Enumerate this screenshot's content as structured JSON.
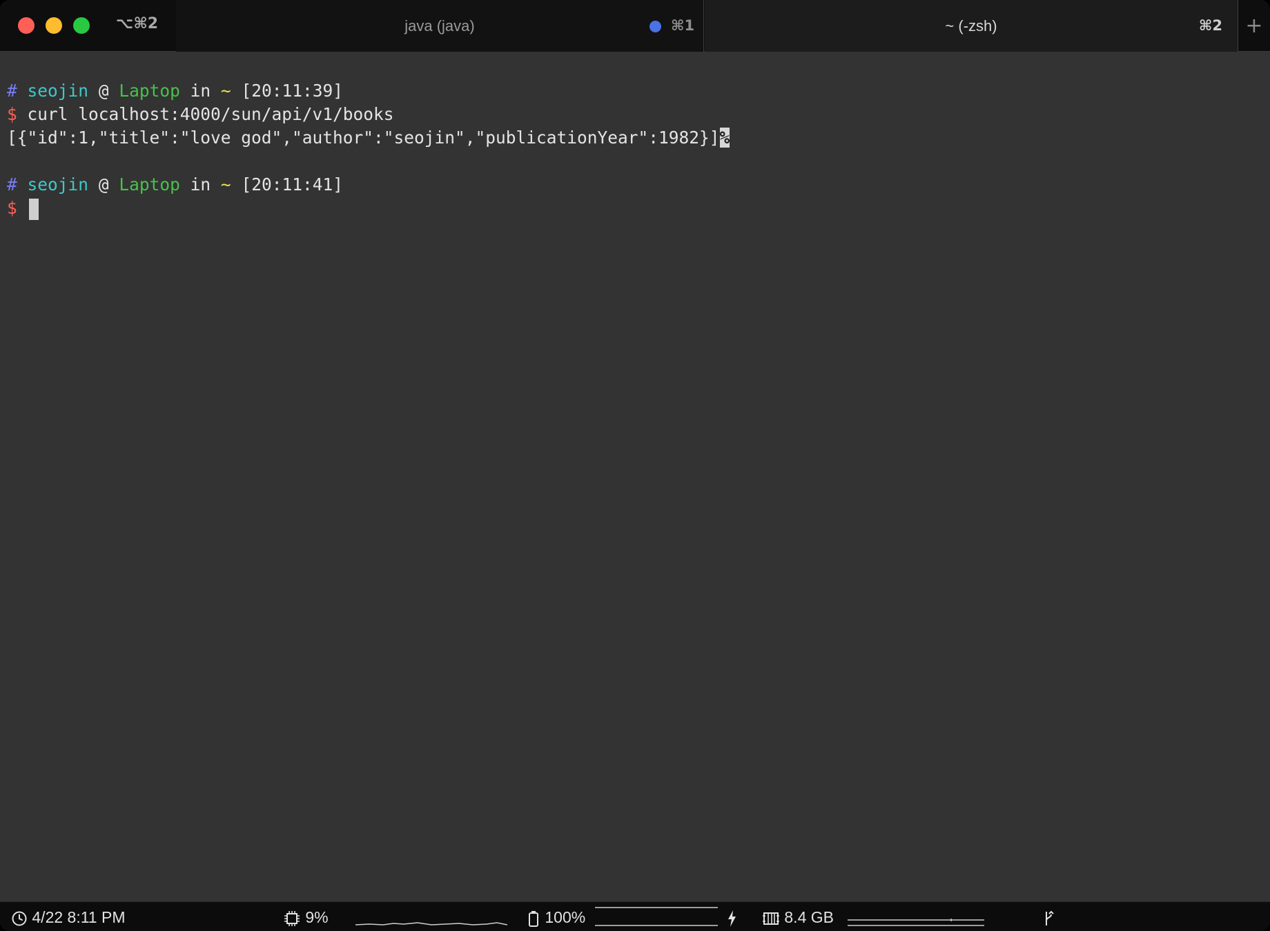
{
  "window": {
    "shortcut": "⌥⌘2"
  },
  "tabs": [
    {
      "title": "java (java)",
      "shortcut": "⌘1",
      "activity_dot_color": "#4a72e6"
    },
    {
      "title": "~ (-zsh)",
      "shortcut": "⌘2"
    }
  ],
  "new_tab": "+",
  "terminal": {
    "prompt1": {
      "hash": "#",
      "user": "seojin",
      "at": "@",
      "host": "Laptop",
      "in": "in",
      "dir": "~",
      "time": "[20:11:39]"
    },
    "command1": {
      "symbol": "$",
      "text": "curl localhost:4000/sun/api/v1/books"
    },
    "output1": {
      "text": "[{\"id\":1,\"title\":\"love god\",\"author\":\"seojin\",\"publicationYear\":1982}]",
      "eol_mark": "%"
    },
    "prompt2": {
      "hash": "#",
      "user": "seojin",
      "at": "@",
      "host": "Laptop",
      "in": "in",
      "dir": "~",
      "time": "[20:11:41]"
    },
    "command2": {
      "symbol": "$",
      "text": ""
    }
  },
  "status_bar": {
    "clock": "4/22 8:11 PM",
    "cpu": "9%",
    "battery": "100%",
    "memory": "8.4 GB"
  },
  "colors": {
    "background": "#333333",
    "prompt_hash": "#7a7cf4",
    "user": "#3ec8c8",
    "host": "#48c14a",
    "dir": "#f3e24a",
    "dollar": "#ff5f57"
  }
}
